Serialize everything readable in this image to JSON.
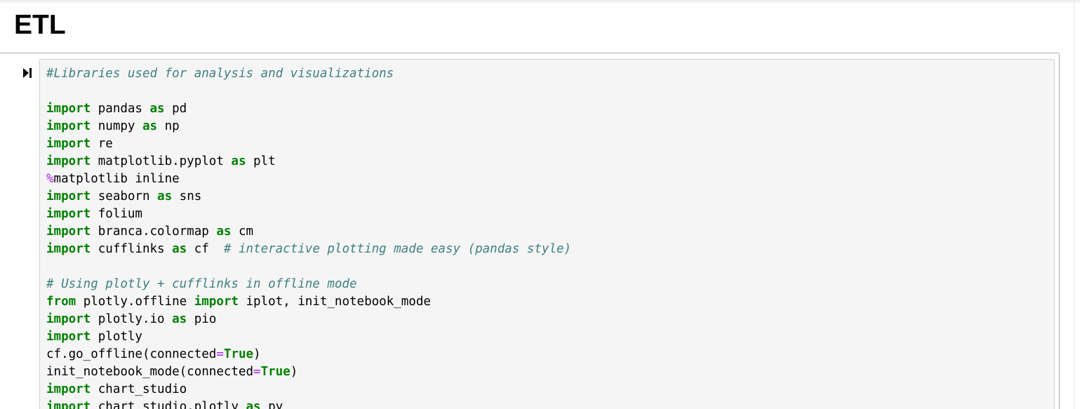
{
  "heading": "ETL",
  "cell": {
    "run_icon": "run-cell-icon",
    "code_lines": [
      [
        {
          "t": "#Libraries used for analysis and visualizations",
          "c": "cm"
        }
      ],
      [],
      [
        {
          "t": "import",
          "c": "kw"
        },
        {
          "t": " pandas "
        },
        {
          "t": "as",
          "c": "kw"
        },
        {
          "t": " pd"
        }
      ],
      [
        {
          "t": "import",
          "c": "kw"
        },
        {
          "t": " numpy "
        },
        {
          "t": "as",
          "c": "kw"
        },
        {
          "t": " np"
        }
      ],
      [
        {
          "t": "import",
          "c": "kw"
        },
        {
          "t": " re"
        }
      ],
      [
        {
          "t": "import",
          "c": "kw"
        },
        {
          "t": " matplotlib.pyplot "
        },
        {
          "t": "as",
          "c": "kw"
        },
        {
          "t": " plt"
        }
      ],
      [
        {
          "t": "%",
          "c": "op"
        },
        {
          "t": "matplotlib inline"
        }
      ],
      [
        {
          "t": "import",
          "c": "kw"
        },
        {
          "t": " seaborn "
        },
        {
          "t": "as",
          "c": "kw"
        },
        {
          "t": " sns"
        }
      ],
      [
        {
          "t": "import",
          "c": "kw"
        },
        {
          "t": " folium"
        }
      ],
      [
        {
          "t": "import",
          "c": "kw"
        },
        {
          "t": " branca.colormap "
        },
        {
          "t": "as",
          "c": "kw"
        },
        {
          "t": " cm"
        }
      ],
      [
        {
          "t": "import",
          "c": "kw"
        },
        {
          "t": " cufflinks "
        },
        {
          "t": "as",
          "c": "kw"
        },
        {
          "t": " cf  "
        },
        {
          "t": "# interactive plotting made easy (pandas style)",
          "c": "cm"
        }
      ],
      [],
      [
        {
          "t": "# Using plotly + cufflinks in offline mode",
          "c": "cm"
        }
      ],
      [
        {
          "t": "from",
          "c": "kw"
        },
        {
          "t": " plotly.offline "
        },
        {
          "t": "import",
          "c": "kw"
        },
        {
          "t": " iplot, init_notebook_mode"
        }
      ],
      [
        {
          "t": "import",
          "c": "kw"
        },
        {
          "t": " plotly.io "
        },
        {
          "t": "as",
          "c": "kw"
        },
        {
          "t": " pio"
        }
      ],
      [
        {
          "t": "import",
          "c": "kw"
        },
        {
          "t": " plotly"
        }
      ],
      [
        {
          "t": "cf.go_offline(connected"
        },
        {
          "t": "=",
          "c": "op"
        },
        {
          "t": "True",
          "c": "kw"
        },
        {
          "t": ")"
        }
      ],
      [
        {
          "t": "init_notebook_mode(connected"
        },
        {
          "t": "=",
          "c": "op"
        },
        {
          "t": "True",
          "c": "kw"
        },
        {
          "t": ")"
        }
      ],
      [
        {
          "t": "import",
          "c": "kw"
        },
        {
          "t": " chart_studio"
        }
      ],
      [
        {
          "t": "import",
          "c": "kw"
        },
        {
          "t": " chart_studio.plotly "
        },
        {
          "t": "as",
          "c": "kw"
        },
        {
          "t": " py"
        }
      ]
    ]
  }
}
